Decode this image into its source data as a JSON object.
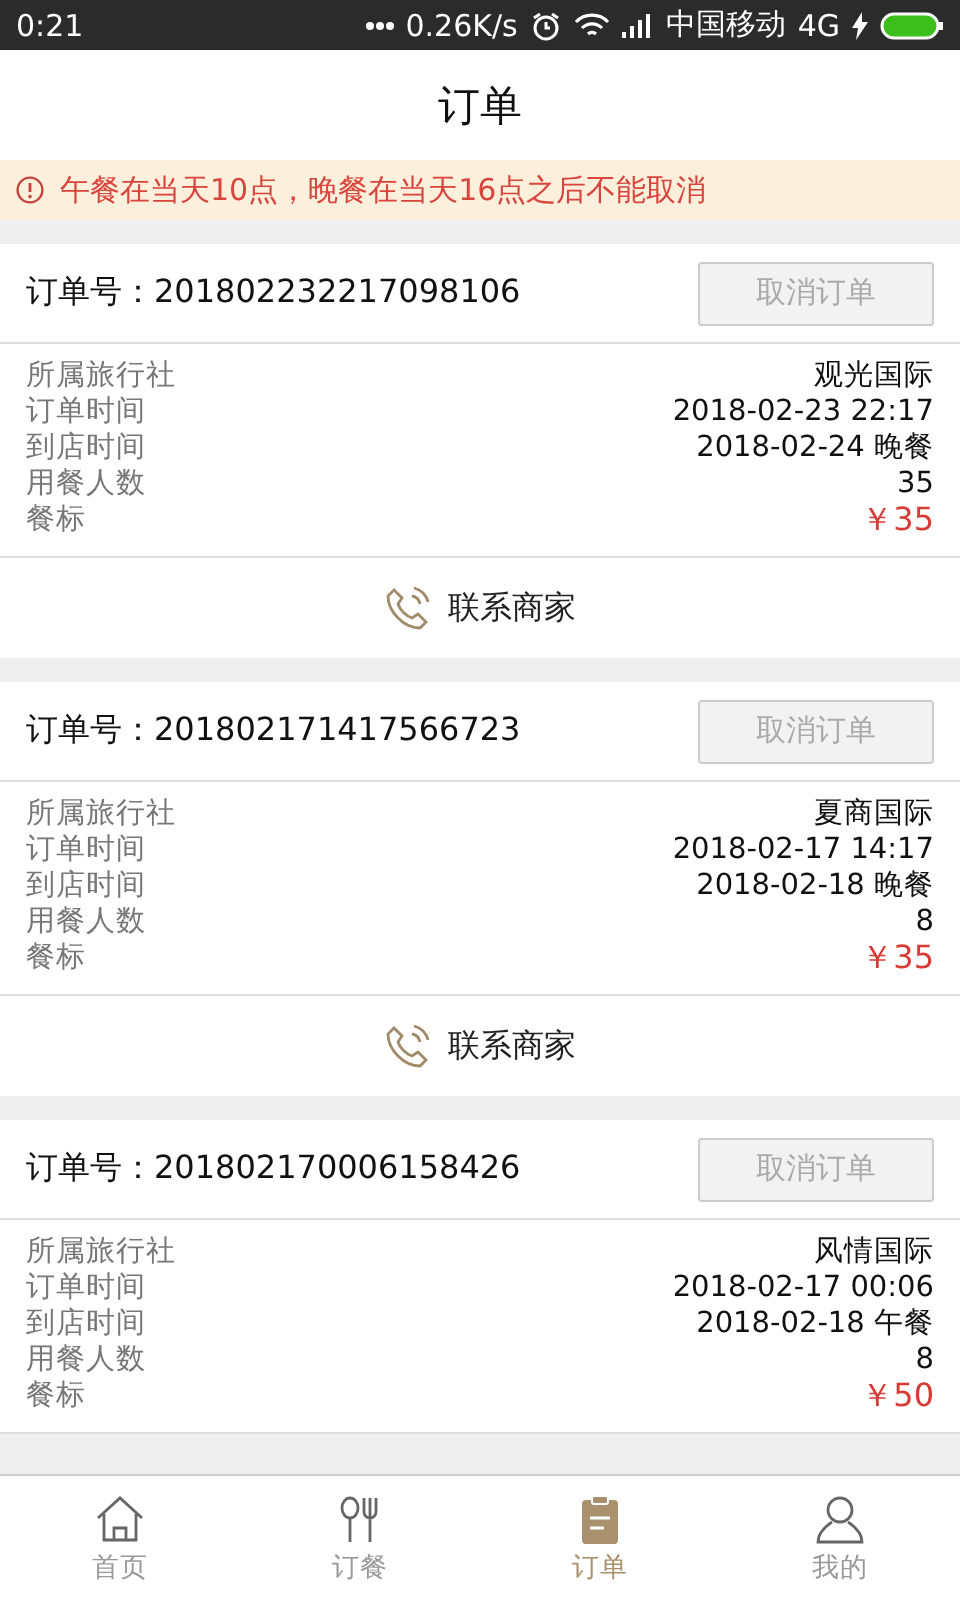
{
  "status_bar": {
    "time": "0:21",
    "speed": "0.26K/s",
    "carrier": "中国移动",
    "network": "4G"
  },
  "header": {
    "title": "订单"
  },
  "notice": {
    "text": "午餐在当天10点，晚餐在当天16点之后不能取消"
  },
  "orders": [
    {
      "number": "订单号：201802232217098106",
      "cancel": "取消订单",
      "cancel_disabled": true,
      "fields": [
        {
          "label": "所属旅行社",
          "value": "观光国际",
          "kind": "plain"
        },
        {
          "label": "订单时间",
          "value": "2018-02-23 22:17",
          "kind": "plain"
        },
        {
          "label": "到店时间",
          "value": "2018-02-24 晚餐",
          "kind": "plain"
        },
        {
          "label": "用餐人数",
          "value": "35",
          "kind": "plain"
        },
        {
          "label": "餐标",
          "value": "￥35",
          "kind": "price"
        }
      ],
      "contact": "联系商家"
    },
    {
      "number": "订单号：201802171417566723",
      "cancel": "取消订单",
      "cancel_disabled": true,
      "fields": [
        {
          "label": "所属旅行社",
          "value": "夏商国际",
          "kind": "plain"
        },
        {
          "label": "订单时间",
          "value": "2018-02-17 14:17",
          "kind": "plain"
        },
        {
          "label": "到店时间",
          "value": "2018-02-18 晚餐",
          "kind": "plain"
        },
        {
          "label": "用餐人数",
          "value": "8",
          "kind": "plain"
        },
        {
          "label": "餐标",
          "value": "￥35",
          "kind": "price"
        }
      ],
      "contact": "联系商家"
    },
    {
      "number": "订单号：201802170006158426",
      "cancel": "取消订单",
      "cancel_disabled": true,
      "fields": [
        {
          "label": "所属旅行社",
          "value": "风情国际",
          "kind": "plain"
        },
        {
          "label": "订单时间",
          "value": "2018-02-17 00:06",
          "kind": "plain"
        },
        {
          "label": "到店时间",
          "value": "2018-02-18 午餐",
          "kind": "plain"
        },
        {
          "label": "用餐人数",
          "value": "8",
          "kind": "plain"
        },
        {
          "label": "餐标",
          "value": "￥50",
          "kind": "price"
        }
      ]
    }
  ],
  "tabs": [
    {
      "label": "首页",
      "kind": "home",
      "selected": false
    },
    {
      "label": "订餐",
      "kind": "cutlery",
      "selected": false
    },
    {
      "label": "订单",
      "kind": "clipboard",
      "selected": true
    },
    {
      "label": "我的",
      "kind": "person",
      "selected": false
    }
  ]
}
